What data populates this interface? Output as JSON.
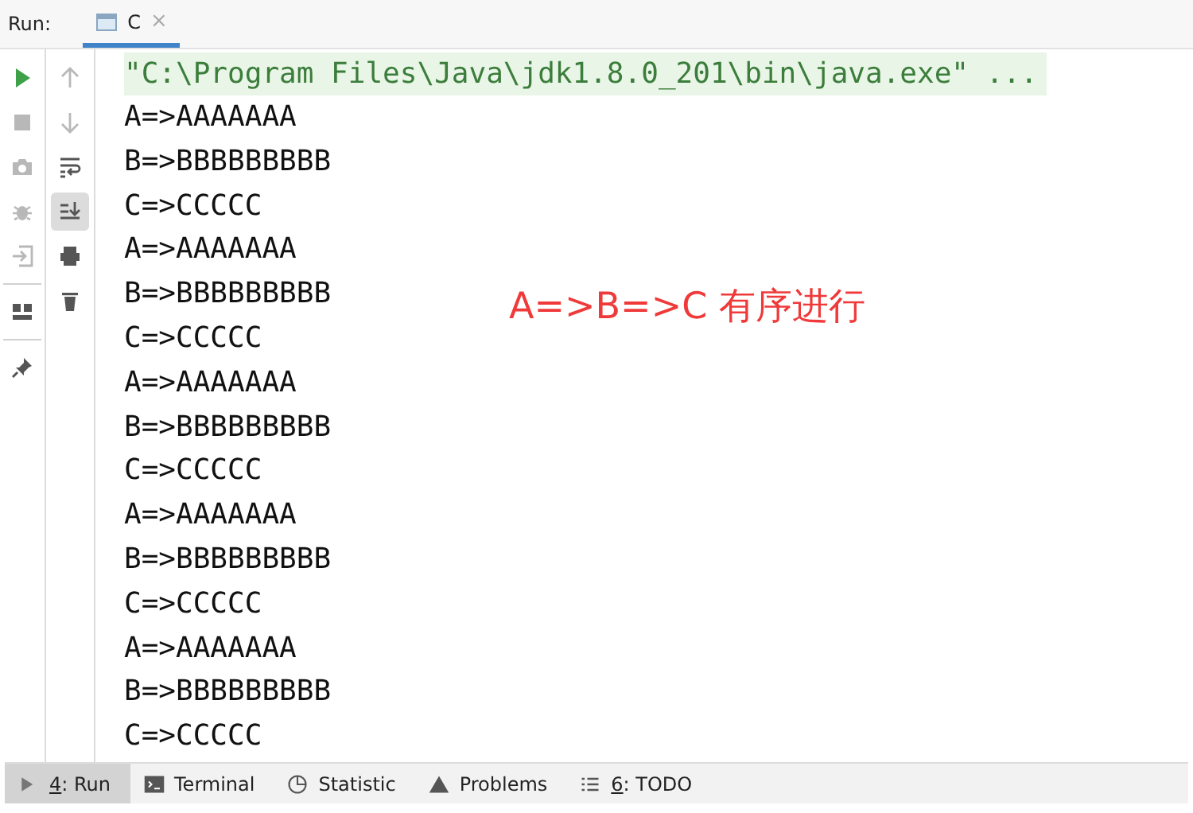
{
  "header": {
    "label": "Run:",
    "tabs": [
      {
        "label": "C",
        "selected": true,
        "close": "×"
      }
    ]
  },
  "run_toolbar": [
    {
      "kind": "play",
      "disabled": false
    },
    {
      "kind": "stop",
      "disabled": true
    },
    {
      "kind": "camera",
      "disabled": true
    },
    {
      "kind": "bug",
      "disabled": true
    },
    {
      "kind": "exit",
      "disabled": true
    },
    {
      "kind": "divider"
    },
    {
      "kind": "layout",
      "disabled": false
    },
    {
      "kind": "divider"
    },
    {
      "kind": "pin",
      "disabled": false
    }
  ],
  "console_toolbar": [
    {
      "kind": "up",
      "disabled": true,
      "selected": false
    },
    {
      "kind": "down",
      "disabled": true,
      "selected": false
    },
    {
      "kind": "wrap",
      "disabled": false,
      "selected": false
    },
    {
      "kind": "scroll-end",
      "disabled": false,
      "selected": true
    },
    {
      "kind": "print",
      "disabled": false,
      "selected": false
    },
    {
      "kind": "trash",
      "disabled": false,
      "selected": false
    }
  ],
  "console": {
    "command": "\"C:\\Program Files\\Java\\jdk1.8.0_201\\bin\\java.exe\" ...",
    "lines": [
      "A=>AAAAAAA",
      "B=>BBBBBBBBB",
      "C=>CCCCC",
      "A=>AAAAAAA",
      "B=>BBBBBBBBB",
      "C=>CCCCC",
      "A=>AAAAAAA",
      "B=>BBBBBBBBB",
      "C=>CCCCC",
      "A=>AAAAAAA",
      "B=>BBBBBBBBB",
      "C=>CCCCC",
      "A=>AAAAAAA",
      "B=>BBBBBBBBB",
      "C=>CCCCC"
    ]
  },
  "annotation": "A=>B=>C 有序进行",
  "tool_windows": [
    {
      "kind": "run",
      "mnemonic": "4",
      "label": ": Run",
      "selected": true
    },
    {
      "kind": "terminal",
      "label": "Terminal",
      "selected": false
    },
    {
      "kind": "statistic",
      "label": "Statistic",
      "selected": false
    },
    {
      "kind": "problems",
      "label": "Problems",
      "selected": false
    },
    {
      "kind": "todo",
      "mnemonic": "6",
      "label": ": TODO",
      "selected": false
    }
  ]
}
